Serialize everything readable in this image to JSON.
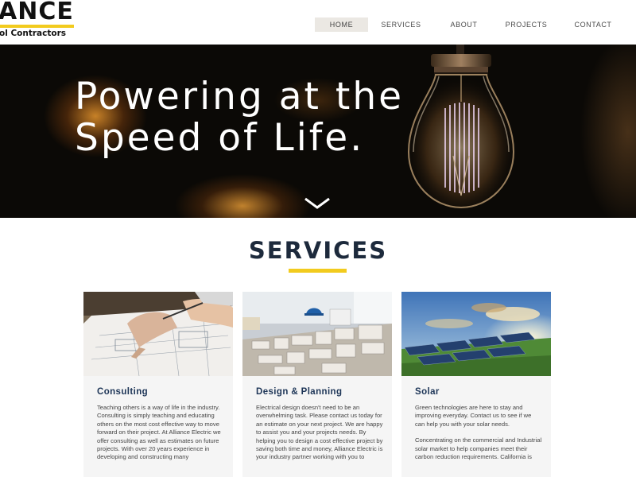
{
  "logo": {
    "name": "ANCE",
    "tagline": "ol Contractors",
    "accent_color": "#f2cb1e"
  },
  "nav": {
    "items": [
      {
        "label": "HOME",
        "active": true
      },
      {
        "label": "SERVICES",
        "active": false
      },
      {
        "label": "ABOUT",
        "active": false
      },
      {
        "label": "PROJECTS",
        "active": false
      },
      {
        "label": "CONTACT",
        "active": false
      }
    ]
  },
  "hero": {
    "title": "Powering at the Speed of Life.",
    "scroll_icon": "chevron-down-icon",
    "image": "light-bulb"
  },
  "services": {
    "heading": "SERVICES",
    "cards": [
      {
        "title": "Consulting",
        "image": "blueprint-hands",
        "paragraphs": [
          "Teaching others is a way of life in the industry. Consulting is simply teaching and educating others on the most cost effective way to move forward on their project. At Alliance Electric we offer consulting as well as estimates on future projects. With over 20 years experience in developing and constructing many"
        ]
      },
      {
        "title": "Design & Planning",
        "image": "architectural-model",
        "paragraphs": [
          "Electrical design doesn't need to be an overwhelming task. Please contact us today for an estimate on your next project. We are happy to assist you and your projects needs. By helping you to design a cost effective project by saving both time and money, Alliance Electric is your industry partner working with you to"
        ]
      },
      {
        "title": "Solar",
        "image": "solar-panels",
        "paragraphs": [
          "Green technologies are here to stay and improving everyday. Contact us to see if we can help you with your solar needs.",
          "Concentrating on the commercial and Industrial solar market to help companies meet their carbon reduction requirements. California is"
        ]
      }
    ]
  }
}
